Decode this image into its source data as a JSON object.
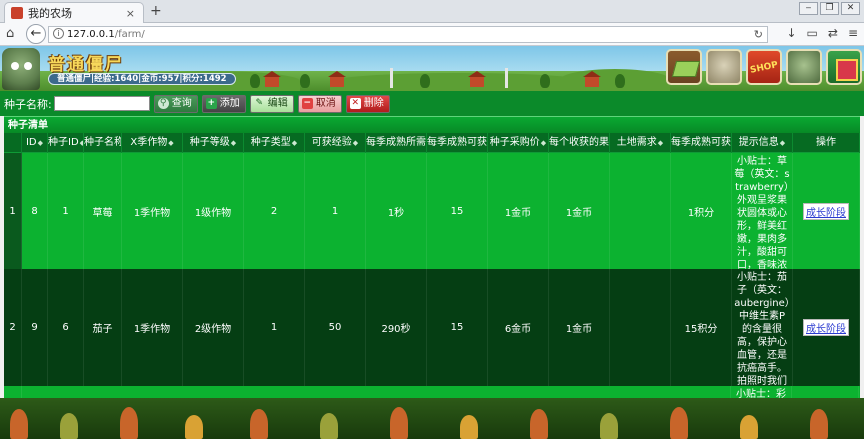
{
  "browser": {
    "tab_title": "我的农场",
    "tab_close": "×",
    "new_tab": "+",
    "url_host": "127.0.0.1",
    "url_path": "/farm/",
    "window_controls": [
      "‒",
      "❐",
      "✕"
    ]
  },
  "banner": {
    "site_title": "普通僵尸",
    "user_stats": "普通僵尸|经验:1640|金币:957|积分:1492",
    "nav_icons": [
      "farm-icon",
      "zombie-icon",
      "shop-icon",
      "zombie-head-icon",
      "gift-icon"
    ],
    "shop_label": "SHOP"
  },
  "toolbar": {
    "seed_name_label": "种子名称:",
    "seed_name_value": "",
    "search_label": "查询",
    "add_label": "添加",
    "edit_label": "编辑",
    "cancel_label": "取消",
    "delete_label": "删除"
  },
  "panel": {
    "title": "种子清单"
  },
  "table": {
    "columns": [
      "ID",
      "种子ID",
      "种子名称",
      "X季作物",
      "种子等级",
      "种子类型",
      "可获经验",
      "每季成熟所需时间",
      "每季成熟可获果实",
      "种子采购价",
      "每个收获的果实",
      "土地需求",
      "每季成熟可获积分",
      "提示信息",
      "操作"
    ],
    "rows": [
      {
        "row_num": "1",
        "id": "8",
        "seed_id": "1",
        "name": "草莓",
        "season": "1季作物",
        "level": "1级作物",
        "type": "2",
        "exp": "1",
        "time": "1秒",
        "fruit": "15",
        "price": "1金币",
        "fruit_price": "1金币",
        "land": "",
        "points": "1积分",
        "tip": "小贴士：草莓（英文：strawberry）外观呈浆果状圆体或心形，鲜美红嫩，果肉多汁，酸甜可口，香味浓郁，被称为水果皇后。",
        "action": "成长阶段"
      },
      {
        "row_num": "2",
        "id": "9",
        "seed_id": "6",
        "name": "茄子",
        "season": "1季作物",
        "level": "2级作物",
        "type": "1",
        "exp": "50",
        "time": "290秒",
        "fruit": "15",
        "price": "6金币",
        "fruit_price": "1金币",
        "land": "",
        "points": "15积分",
        "tip": "小贴士：茄子（英文：aubergine）中维生素P的含量很高，保护心血管，还是抗癌高手。拍照时我们还喜欢一起喊茄子微笑。",
        "action": "成长阶段"
      },
      {
        "row_num": "",
        "tip": "小贴士：彩椒"
      }
    ]
  },
  "colors": {
    "toolbar_green": "#0b8a2a",
    "row_light": "#0cb230",
    "row_dark": "#053e13",
    "header_green": "#066b22"
  }
}
